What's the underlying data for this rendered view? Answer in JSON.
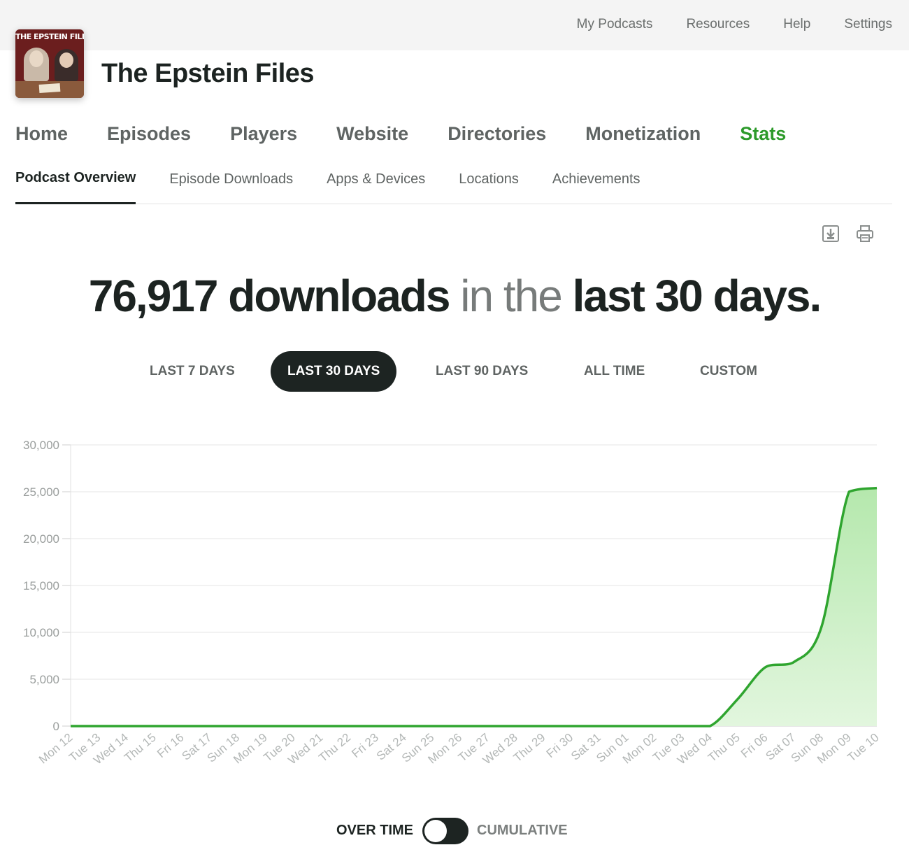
{
  "topnav": [
    {
      "label": "My Podcasts"
    },
    {
      "label": "Resources"
    },
    {
      "label": "Help"
    },
    {
      "label": "Settings"
    }
  ],
  "podcast": {
    "title": "The Epstein Files",
    "cover_text": "THE EPSTEIN FILES"
  },
  "mainnav": [
    {
      "label": "Home"
    },
    {
      "label": "Episodes"
    },
    {
      "label": "Players"
    },
    {
      "label": "Website"
    },
    {
      "label": "Directories"
    },
    {
      "label": "Monetization"
    },
    {
      "label": "Stats",
      "active": true
    }
  ],
  "subnav": [
    {
      "label": "Podcast Overview",
      "active": true
    },
    {
      "label": "Episode Downloads"
    },
    {
      "label": "Apps & Devices"
    },
    {
      "label": "Locations"
    },
    {
      "label": "Achievements"
    }
  ],
  "tools": {
    "download_icon": "download-icon",
    "print_icon": "print-icon"
  },
  "headline": {
    "count": "76,917 downloads",
    "mid": " in the ",
    "period": "last 30 days."
  },
  "ranges": [
    {
      "label": "LAST 7 DAYS"
    },
    {
      "label": "LAST 30 DAYS",
      "active": true
    },
    {
      "label": "LAST 90 DAYS"
    },
    {
      "label": "ALL TIME"
    },
    {
      "label": "CUSTOM"
    }
  ],
  "toggle": {
    "left": "OVER TIME",
    "right": "CUMULATIVE",
    "state": "over_time"
  },
  "colors": {
    "accent": "#2c9a2a",
    "line": "#2fa52f",
    "fill_top": "#b5e8ad",
    "fill_bottom": "#e2f6de",
    "dark": "#1d2422"
  },
  "chart_data": {
    "type": "area",
    "x": [
      "Mon 12",
      "Tue 13",
      "Wed 14",
      "Thu 15",
      "Fri 16",
      "Sat 17",
      "Sun 18",
      "Mon 19",
      "Tue 20",
      "Wed 21",
      "Thu 22",
      "Fri 23",
      "Sat 24",
      "Sun 25",
      "Mon 26",
      "Tue 27",
      "Wed 28",
      "Thu 29",
      "Fri 30",
      "Sat 31",
      "Sun 01",
      "Mon 02",
      "Tue 03",
      "Wed 04",
      "Thu 05",
      "Fri 06",
      "Sat 07",
      "Sun 08",
      "Mon 09",
      "Tue 10"
    ],
    "series": [
      {
        "values": [
          0,
          0,
          0,
          0,
          0,
          0,
          0,
          0,
          0,
          0,
          0,
          0,
          0,
          0,
          0,
          0,
          0,
          0,
          0,
          0,
          0,
          0,
          0,
          0,
          2900,
          6300,
          6800,
          10500,
          25000,
          25400
        ]
      }
    ],
    "yticks": [
      "0",
      "5,000",
      "10,000",
      "15,000",
      "20,000",
      "25,000",
      "30,000"
    ],
    "ylim": [
      0,
      30000
    ],
    "grid": true,
    "legend": "none"
  }
}
